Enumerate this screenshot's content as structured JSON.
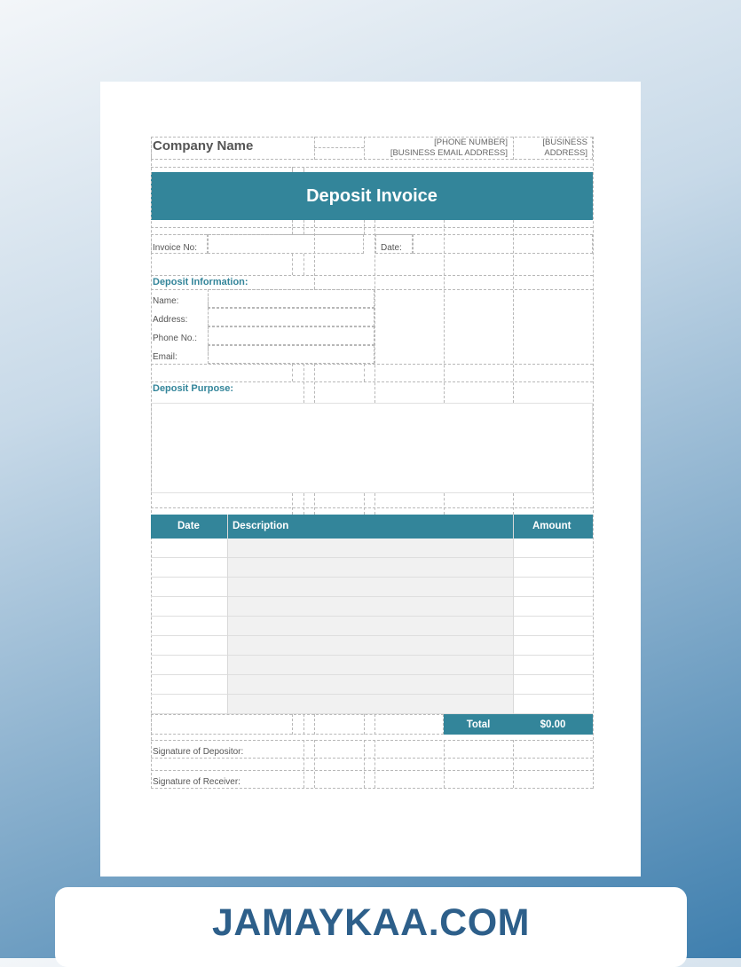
{
  "header": {
    "company_name": "Company Name",
    "phone": "[PHONE NUMBER]",
    "email": "[BUSINESS EMAIL ADDRESS]",
    "address_line1": "[BUSINESS",
    "address_line2": "ADDRESS]"
  },
  "title": "Deposit Invoice",
  "fields": {
    "invoice_no_label": "Invoice No:",
    "date_label": "Date:"
  },
  "deposit_information": {
    "title": "Deposit Information:",
    "name_label": "Name:",
    "address_label": "Address:",
    "phone_label": "Phone No.:",
    "email_label": "Email:"
  },
  "deposit_purpose": {
    "title": "Deposit Purpose:"
  },
  "table": {
    "headers": {
      "date": "Date",
      "description": "Description",
      "amount": "Amount"
    },
    "row_count": 9,
    "total_label": "Total",
    "total_value": "$0.00"
  },
  "signatures": {
    "depositor_label": "Signature of Depositor:",
    "receiver_label": "Signature of Receiver:"
  },
  "footer": {
    "brand": "JAMAYKAA.COM"
  },
  "colors": {
    "accent": "#33859a",
    "brand": "#2d5f8a"
  }
}
